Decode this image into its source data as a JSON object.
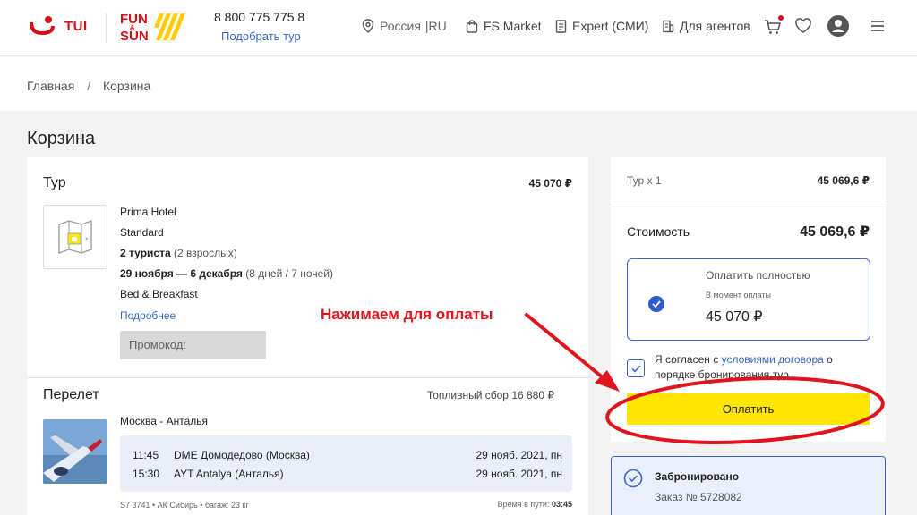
{
  "header": {
    "brand_tui": "TUI",
    "brand_funsun_line1": "FUN",
    "brand_funsun_amp": "&",
    "brand_funsun_line2": "SUN",
    "phone": "8 800 775 775 8",
    "pick_tour": "Подобрать тур",
    "nav": {
      "region": "Россия",
      "region_code": "|RU",
      "market": "FS Market",
      "expert": "Expert (СМИ)",
      "agents": "Для агентов"
    }
  },
  "breadcrumb": {
    "home": "Главная",
    "separator": "/",
    "current": "Корзина"
  },
  "page_title": "Корзина",
  "tour": {
    "title": "Тур",
    "price": "45 070 ₽",
    "hotel_name": "Prima Hotel",
    "room": "Standard",
    "tourists_bold": "2 туриста",
    "tourists_rest": "(2 взрослых)",
    "dates_bold": "29 ноября — 6 декабря",
    "dates_rest": "(8 дней / 7 ночей)",
    "meal": "Bed & Breakfast",
    "more_link": "Подробнее",
    "promo_placeholder": "Промокод:"
  },
  "flight": {
    "title": "Перелет",
    "fuel_fee": "Топливный сбор 16 880 ₽",
    "route": "Москва - Анталья",
    "legs": [
      {
        "time": "11:45",
        "airport": "DME Домодедово (Москва)",
        "date": "29 нояб. 2021, пн"
      },
      {
        "time": "15:30",
        "airport": "AYT Antalya (Анталья)",
        "date": "29 нояб. 2021, пн"
      }
    ],
    "meta": "S7 3741 • АК Сибирь • багаж: 23 кг",
    "duration_label": "Время в пути:",
    "duration_value": "03:45"
  },
  "summary": {
    "tour_count": "Тур x 1",
    "tour_price": "45 069,6 ₽",
    "cost_label": "Стоимость",
    "cost_value": "45 069,6 ₽",
    "pay_option_title": "Оплатить полностью",
    "pay_option_sub": "В момент оплаты",
    "pay_option_amount": "45 070 ₽",
    "agree_prefix": "Я согласен с ",
    "agree_link": "условиями договора",
    "agree_suffix": " о порядке бронирования тур",
    "pay_button": "Оплатить"
  },
  "booked": {
    "title": "Забронировано",
    "order": "Заказ № 5728082"
  },
  "annotation": {
    "text": "Нажимаем для оплаты"
  },
  "colors": {
    "tui_red": "#d40e14",
    "link_blue": "#3a68c8",
    "pay_yellow": "#ffe600",
    "annotation_red": "#e0141d"
  }
}
